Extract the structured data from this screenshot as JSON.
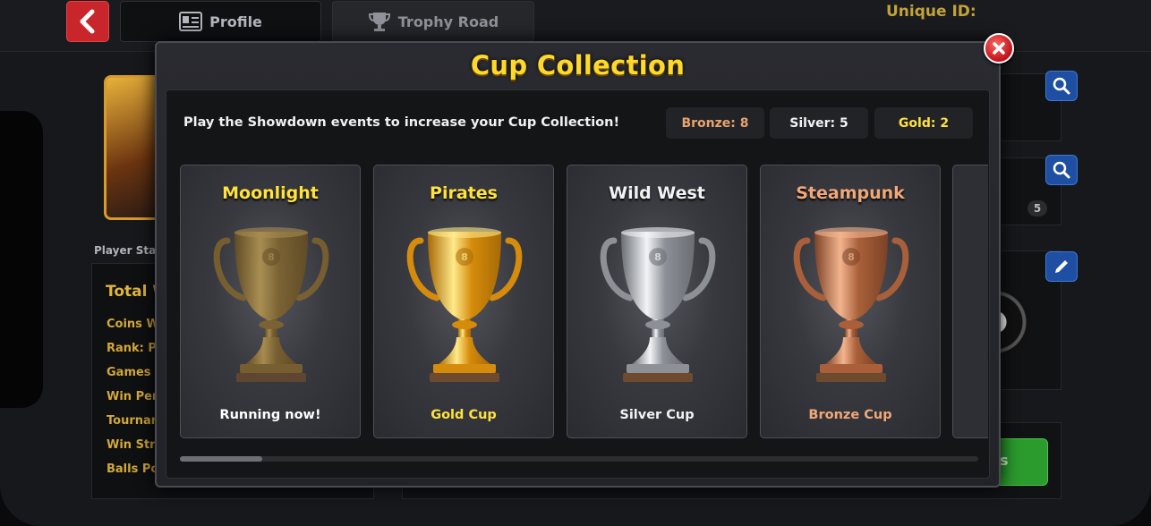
{
  "header": {
    "back_icon": "chevron-left-icon",
    "tabs": [
      {
        "label": "Profile",
        "icon": "profile-card-icon"
      },
      {
        "label": "Trophy Road",
        "icon": "trophy-icon"
      }
    ],
    "unique_id_label": "Unique ID:"
  },
  "background": {
    "player_stats_label": "Player Stat",
    "stats_title": "Total W",
    "stat_rows": [
      "Coins W",
      "Rank: Pr",
      "Games W",
      "Win Per",
      "Tournar",
      "Win Stre",
      "Balls Po"
    ],
    "badge_count": "5",
    "green_button_fragment": "s"
  },
  "modal": {
    "title": "Cup Collection",
    "instruction": "Play the Showdown events to increase your Cup Collection!",
    "counts": {
      "bronze": "Bronze: 8",
      "silver": "Silver: 5",
      "gold": "Gold: 2"
    },
    "cards": [
      {
        "name": "Moonlight",
        "status": "Running now!",
        "cup": "faded-gold",
        "name_color": "#ffe23c",
        "status_color": "#ffffff"
      },
      {
        "name": "Pirates",
        "status": "Gold Cup",
        "cup": "gold",
        "name_color": "#ffe23c",
        "status_color": "#ffe23c"
      },
      {
        "name": "Wild West",
        "status": "Silver Cup",
        "cup": "silver",
        "name_color": "#f2f2f2",
        "status_color": "#f2f2f2"
      },
      {
        "name": "Steampunk",
        "status": "Bronze Cup",
        "cup": "bronze",
        "name_color": "#f0a878",
        "status_color": "#f0a878"
      }
    ],
    "scroll_position": 0.1
  },
  "colors": {
    "accent_gold": "#ffd92a",
    "bronze": "#e8a36e",
    "silver": "#f2f2f2",
    "close_red": "#d21a22"
  }
}
